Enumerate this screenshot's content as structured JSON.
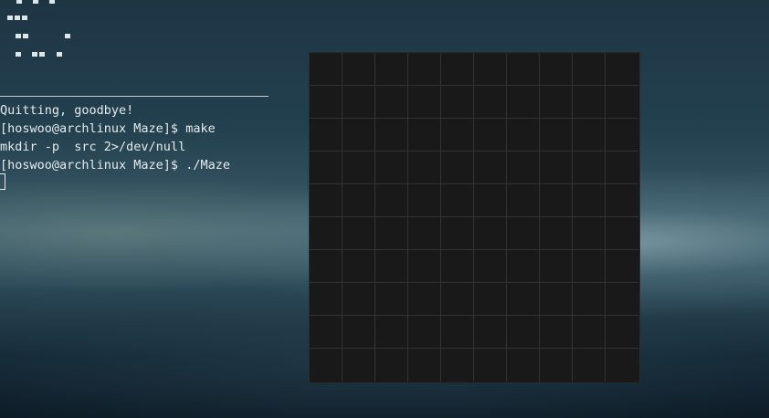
{
  "terminal": {
    "lines": [
      "Quitting, goodbye!",
      "[hoswoo@archlinux Maze]$ make",
      "mkdir -p  src 2>/dev/null",
      "[hoswoo@archlinux Maze]$ ./Maze"
    ]
  },
  "maze_window": {
    "rows": 10,
    "columns": 10,
    "background_color": "#191919",
    "grid_line_color": "#323232"
  }
}
